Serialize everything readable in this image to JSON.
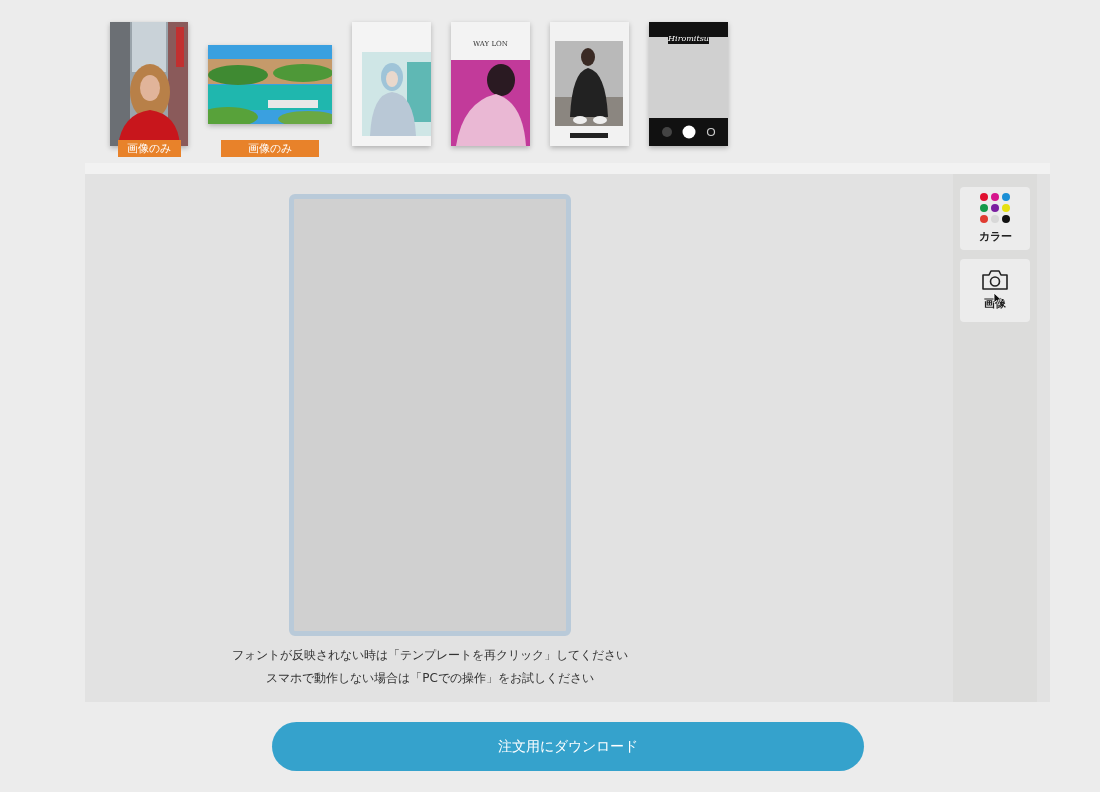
{
  "templates": [
    {
      "badge": "画像のみ"
    },
    {
      "badge": "画像のみ"
    },
    {
      "kind": "photo-card"
    },
    {
      "kind": "magazine",
      "title": "WAY LON"
    },
    {
      "kind": "frame"
    },
    {
      "kind": "camera",
      "title": "Hiromitsu"
    }
  ],
  "tools": [
    {
      "kind": "color",
      "label": "カラー",
      "swatches": [
        {
          "color": "#e0102f"
        },
        {
          "color": "#d6158c"
        },
        {
          "color": "#1a8fd6"
        },
        {
          "color": "#159a4a"
        },
        {
          "color": "#7a1fa0"
        },
        {
          "color": "#e6e010"
        },
        {
          "color": "#e03c31"
        },
        {
          "color": "#d8d8d8"
        },
        {
          "color": "#111111"
        }
      ]
    },
    {
      "label": "画像"
    }
  ],
  "notes": [
    "フォントが反映されない時は「テンプレートを再クリック」してください",
    "スマホで動作しない場合は「PCでの操作」をお試しください"
  ],
  "download_button": "注文用にダウンロード"
}
